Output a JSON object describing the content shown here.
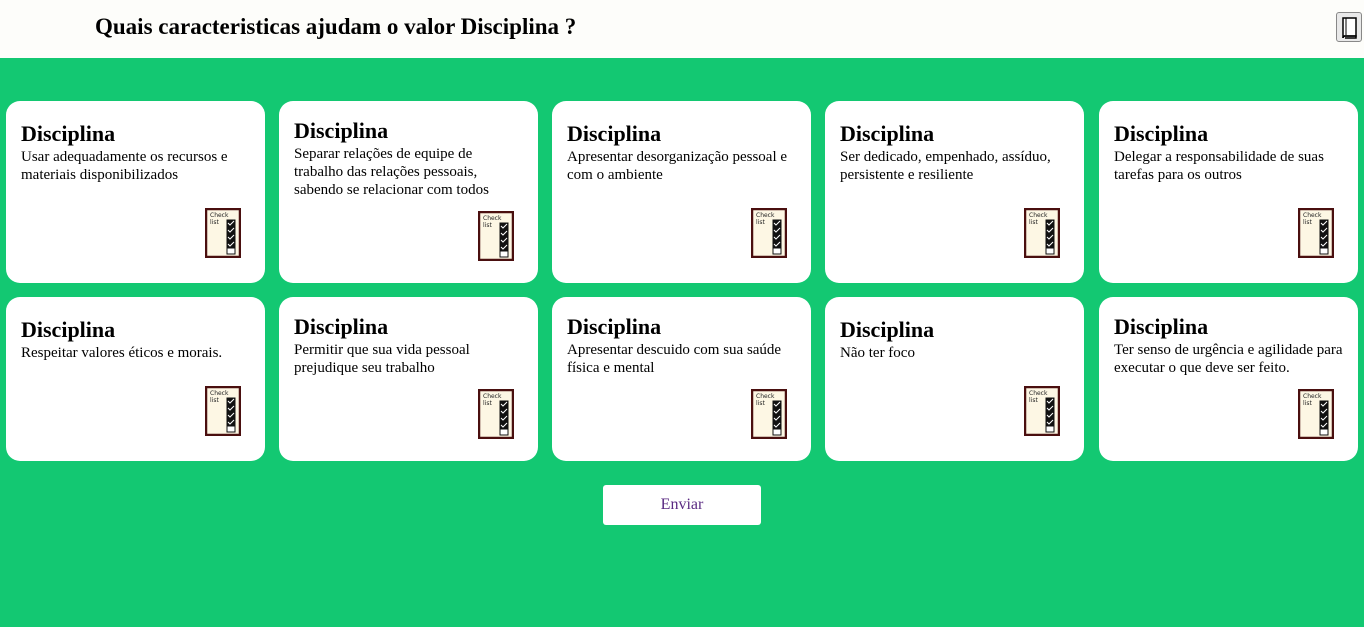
{
  "header": {
    "title": "Quais caracteristicas ajudam o valor Disciplina ?",
    "book_icon": "book-icon"
  },
  "cards": [
    {
      "title": "Disciplina",
      "text": "Usar adequadamente os recursos e materiais disponibilizados"
    },
    {
      "title": "Disciplina",
      "text": "Separar relações de equipe de trabalho das relações pessoais, sabendo se relacionar com todos"
    },
    {
      "title": "Disciplina",
      "text": "Apresentar desorganização pessoal e com o ambiente"
    },
    {
      "title": "Disciplina",
      "text": "Ser dedicado, empenhado, assíduo, persistente e resiliente"
    },
    {
      "title": "Disciplina",
      "text": "Delegar a responsabilidade de suas tarefas para os outros"
    },
    {
      "title": "Disciplina",
      "text": "Respeitar valores éticos e morais."
    },
    {
      "title": "Disciplina",
      "text": "Permitir que sua vida pessoal prejudique seu trabalho"
    },
    {
      "title": "Disciplina",
      "text": "Apresentar descuido com sua saúde física e mental"
    },
    {
      "title": "Disciplina",
      "text": "Não ter foco"
    },
    {
      "title": "Disciplina",
      "text": "Ter senso de urgência e agilidade para executar o que deve ser feito."
    }
  ],
  "checklist_icon": {
    "name": "checklist-icon",
    "label_line1": "Check",
    "label_line2": "list"
  },
  "colors": {
    "background": "#13c872",
    "card": "#ffffff",
    "button_text": "#5a2a82"
  },
  "submit": {
    "label": "Enviar"
  }
}
